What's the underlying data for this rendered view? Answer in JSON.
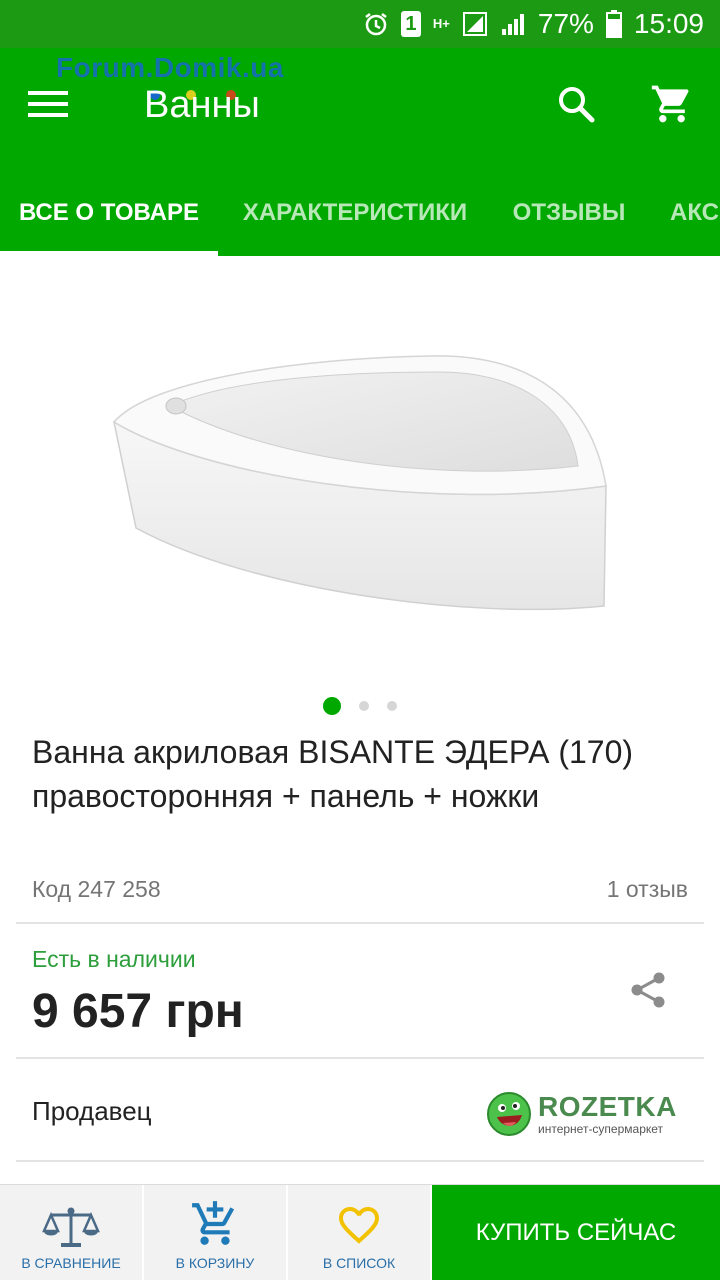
{
  "status_bar": {
    "sim": "1",
    "network": "H+",
    "battery": "77%",
    "time": "15:09"
  },
  "watermark": "Forum.Domik.ua",
  "app_bar": {
    "title": "Ванны"
  },
  "tabs": [
    {
      "label": "ВСЕ О ТОВАРЕ",
      "active": true
    },
    {
      "label": "ХАРАКТЕРИСТИКИ",
      "active": false
    },
    {
      "label": "ОТЗЫВЫ",
      "active": false
    },
    {
      "label": "АКС",
      "active": false
    }
  ],
  "gallery": {
    "image_count": 3,
    "current_index": 1
  },
  "product": {
    "title": "Ванна акриловая BISANTE ЭДЕРА (170) правосторонняя + панель + ножки",
    "code": "Код 247 258",
    "reviews": "1 отзыв",
    "availability": "Есть в наличии",
    "price": "9 657 грн"
  },
  "seller": {
    "label": "Продавец",
    "logo_name": "ROZETKA",
    "logo_tagline": "интернет-супермаркет"
  },
  "bottom_bar": {
    "compare": "В СРАВНЕНИЕ",
    "cart": "В КОРЗИНУ",
    "wishlist": "В СПИСОК",
    "buy": "КУПИТЬ СЕЙЧАС"
  },
  "colors": {
    "primary": "#00a800",
    "status_bar": "#1d9a13",
    "availability": "#2c9e3c",
    "bottom_label": "#2a6fa8",
    "wishlist_icon": "#f2c200"
  }
}
